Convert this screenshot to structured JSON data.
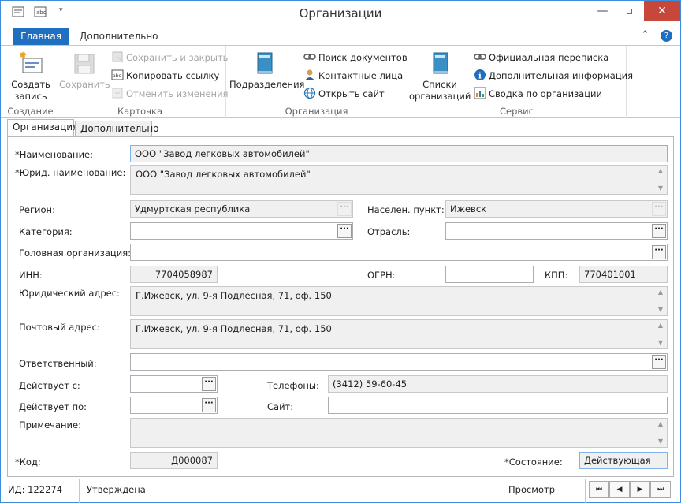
{
  "window": {
    "title": "Организации",
    "qat_icons": [
      "card-icon",
      "abc-icon",
      "dropdown-arrow-icon"
    ]
  },
  "ribbon_tabs": {
    "home": "Главная",
    "extra": "Дополнительно"
  },
  "ribbon": {
    "create": {
      "btn_label_1": "Создать",
      "btn_label_2": "запись",
      "group": "Создание"
    },
    "card": {
      "save": "Сохранить",
      "save_close": "Сохранить и закрыть",
      "copy_link": "Копировать ссылку",
      "undo": "Отменить изменения",
      "group": "Карточка"
    },
    "org": {
      "subdivisions": "Подразделения",
      "search_docs": "Поиск документов",
      "contacts": "Контактные лица",
      "open_site": "Открыть сайт",
      "group": "Организация"
    },
    "service": {
      "lists_1": "Списки",
      "lists_2": "организаций",
      "correspondence": "Официальная переписка",
      "extra_info": "Дополнительная информация",
      "summary": "Сводка по организации",
      "group": "Сервис"
    }
  },
  "form_tabs": {
    "org": "Организация",
    "extra": "Дополнительно"
  },
  "form": {
    "name_label": "*Наименование:",
    "name_value": "ООО \"Завод легковых автомобилей\"",
    "legal_name_label": "*Юрид. наименование:",
    "legal_name_value": "ООО \"Завод легковых автомобилей\"",
    "region_label": "Регион:",
    "region_value": "Удмуртская республика",
    "locality_label": "Населен. пункт:",
    "locality_value": "Ижевск",
    "category_label": "Категория:",
    "category_value": "",
    "industry_label": "Отрасль:",
    "industry_value": "",
    "parent_org_label": "Головная организация:",
    "parent_org_value": "",
    "inn_label": "ИНН:",
    "inn_value": "7704058987",
    "ogrn_label": "ОГРН:",
    "ogrn_value": "",
    "kpp_label": "КПП:",
    "kpp_value": "770401001",
    "legal_addr_label": "Юридический адрес:",
    "legal_addr_value": "Г.Ижевск, ул. 9-я Подлесная, 71, оф. 150",
    "postal_addr_label": "Почтовый адрес:",
    "postal_addr_value": "Г.Ижевск, ул. 9-я Подлесная, 71, оф. 150",
    "responsible_label": "Ответственный:",
    "responsible_value": "",
    "valid_from_label": "Действует с:",
    "valid_from_value": "",
    "phones_label": "Телефоны:",
    "phones_value": "(3412) 59-60-45",
    "valid_to_label": "Действует по:",
    "valid_to_value": "",
    "site_label": "Сайт:",
    "site_value": "",
    "note_label": "Примечание:",
    "note_value": "",
    "code_label": "*Код:",
    "code_value": "Д000087",
    "state_label": "*Состояние:",
    "state_value": "Действующая"
  },
  "statusbar": {
    "id": "ИД: 122274",
    "status": "Утверждена",
    "mode": "Просмотр"
  }
}
